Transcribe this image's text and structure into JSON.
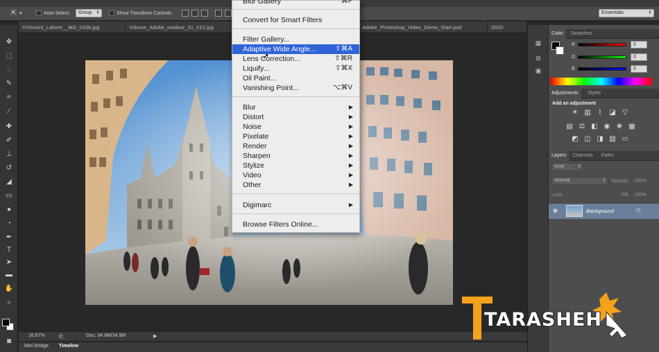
{
  "options_bar": {
    "auto_select_label": "Auto-Select:",
    "auto_select_value": "Group",
    "show_transform_label": "Show Transform Controls",
    "workspace": "Essentials"
  },
  "tabs": [
    {
      "label": "©Vincent_Laforet__MG_0338.jpg"
    },
    {
      "label": "Volume_Adobe_outdoor_01_010.jpg"
    },
    {
      "label": "Adobe_Photoshop_Video_Demo_Start.psd"
    },
    {
      "label": "0020-"
    }
  ],
  "status": {
    "zoom": "16.67%",
    "doc": "Doc: 34.9M/34.9M"
  },
  "bottom_tabs": {
    "mini_bridge": "Mini Bridge",
    "timeline": "Timeline"
  },
  "color_panel": {
    "tabs": [
      "Color",
      "Swatches"
    ],
    "r_label": "R",
    "g_label": "G",
    "b_label": "B",
    "r": "0",
    "g": "0",
    "b": "0"
  },
  "adjustments_panel": {
    "tabs": [
      "Adjustments",
      "Styles"
    ],
    "heading": "Add an adjustment"
  },
  "layers_panel": {
    "tabs": [
      "Layers",
      "Channels",
      "Paths"
    ],
    "kind": "Kind",
    "blend": "Normal",
    "opacity_label": "Opacity:",
    "opacity": "100%",
    "lock_label": "Lock:",
    "fill_label": "Fill:",
    "fill": "100%",
    "layer_name": "Background"
  },
  "filter_menu": {
    "blur_gallery": "Blur Gallery",
    "blur_gallery_sc": "⌘F",
    "convert_smart": "Convert for Smart Filters",
    "filter_gallery": "Filter Gallery...",
    "adaptive": "Adaptive Wide Angle...",
    "adaptive_sc": "⇧⌘A",
    "lens": "Lens Correction...",
    "lens_sc": "⇧⌘R",
    "liquify": "Liquify...",
    "liquify_sc": "⇧⌘X",
    "oil": "Oil Paint...",
    "vanishing": "Vanishing Point...",
    "vanishing_sc": "⌥⌘V",
    "submenus": [
      "Blur",
      "Distort",
      "Noise",
      "Pixelate",
      "Render",
      "Sharpen",
      "Stylize",
      "Video",
      "Other"
    ],
    "digimarc": "Digimarc",
    "browse": "Browse Filters Online..."
  },
  "watermark": {
    "text": "TARASHEH"
  },
  "colors": {
    "highlight": "#2f63d8",
    "panel": "#4d4d4d",
    "watermark_orange": "#f5a21b"
  }
}
